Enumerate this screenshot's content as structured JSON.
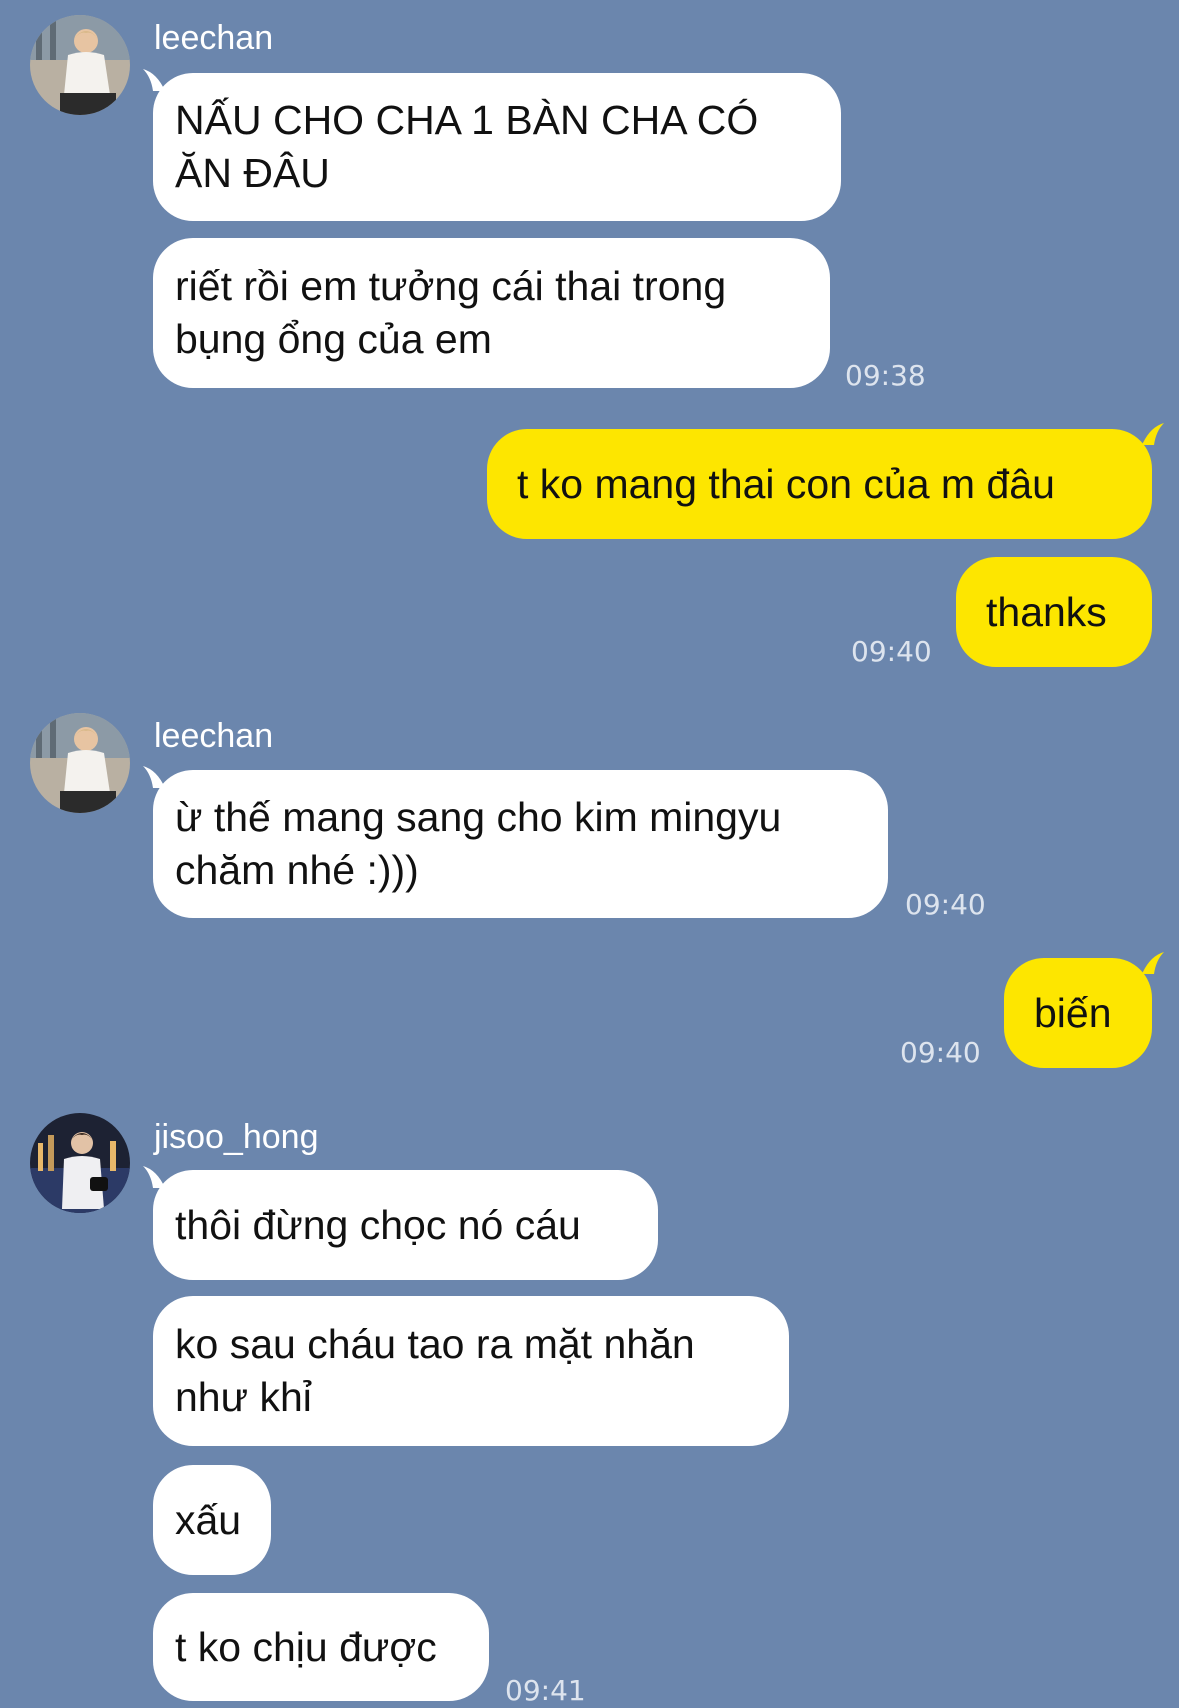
{
  "accent_colors": {
    "background": "#6b86ad",
    "incoming_bubble": "#ffffff",
    "outgoing_bubble": "#fde600"
  },
  "messages": {
    "g1": {
      "sender": "leechan",
      "avatar": "user-avatar-photo",
      "m1_line1": "NẤU CHO CHA 1 BÀN CHA CÓ",
      "m1_line2": "ĂN ĐÂU",
      "m2_line1": "riết rồi em tưởng cái thai trong",
      "m2_line2": "bụng ổng của em",
      "time": "09:38"
    },
    "g2": {
      "m1": "t ko mang thai con của m đâu",
      "m2": "thanks",
      "time": "09:40"
    },
    "g3": {
      "sender": "leechan",
      "avatar": "user-avatar-photo",
      "m1_line1": "ừ thế mang sang cho kim mingyu",
      "m1_line2": "chăm nhé :)))",
      "time": "09:40"
    },
    "g4": {
      "m1": "biến",
      "time": "09:40"
    },
    "g5": {
      "sender": "jisoo_hong",
      "avatar": "user-avatar-photo",
      "m1": "thôi đừng chọc nó cáu",
      "m2_line1": "ko sau cháu tao ra mặt nhăn",
      "m2_line2": "như khỉ",
      "m3": "xấu",
      "m4": "t ko chịu được",
      "time": "09:41"
    }
  }
}
